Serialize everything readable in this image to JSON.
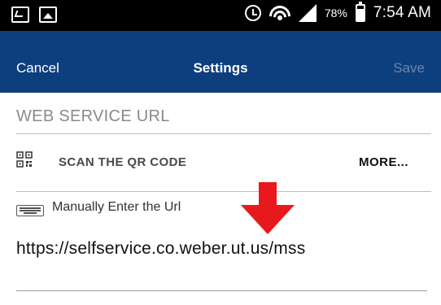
{
  "status_bar": {
    "battery_percent": "78%",
    "time": "7:54 AM",
    "icons": [
      "notification-icon",
      "image-icon",
      "alarm-icon",
      "wifi-icon",
      "signal-icon",
      "battery-icon"
    ]
  },
  "nav": {
    "cancel_label": "Cancel",
    "title": "Settings",
    "save_label": "Save",
    "bar_color": "#0d3f7f",
    "save_color_disabled": "#6b84a8"
  },
  "section": {
    "header": "WEB SERVICE URL"
  },
  "qr": {
    "label": "SCAN THE QR CODE",
    "more_label": "MORE..."
  },
  "manual": {
    "label": "Manually Enter the Url"
  },
  "url_field": {
    "value": "https://selfservice.co.weber.ut.us/mss"
  },
  "annotation": {
    "arrow_color": "#e8191c",
    "arrow_icon": "down-arrow-icon"
  }
}
